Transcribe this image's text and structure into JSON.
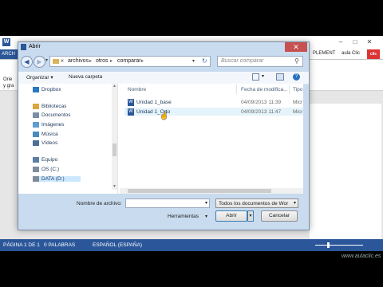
{
  "word": {
    "archivo_tab": "ARCH",
    "ribbon_right_tab": "PLEMENT",
    "account": "aula Clic",
    "ribbon_left_fragments": [
      "Orie",
      "y gra",
      "y"
    ],
    "status": {
      "page": "PÁGINA 1 DE 1",
      "words": "0 PALABRAS",
      "language": "ESPAÑOL (ESPAÑA)"
    }
  },
  "dialog": {
    "title": "Abrir",
    "close": "✕",
    "breadcrumb": [
      "«",
      "archivos",
      "otros",
      "comparar"
    ],
    "search_placeholder": "Buscar comparar",
    "toolbar": {
      "organize": "Organizar ▾",
      "new_folder": "Nueva carpeta"
    },
    "nav": [
      {
        "label": "Dropbox",
        "icon": "dropbox-icon",
        "color": "#2a78c2"
      },
      {
        "label": "Bibliotecas",
        "icon": "libraries-icon",
        "color": "#d9a73d"
      },
      {
        "label": "Documentos",
        "icon": "documents-icon",
        "color": "#7a8fa6"
      },
      {
        "label": "Imágenes",
        "icon": "images-icon",
        "color": "#5f9dcf"
      },
      {
        "label": "Música",
        "icon": "music-icon",
        "color": "#4a8ac0"
      },
      {
        "label": "Vídeos",
        "icon": "videos-icon",
        "color": "#4d6f96"
      },
      {
        "label": "Equipo",
        "icon": "computer-icon",
        "color": "#5a7fa5"
      },
      {
        "label": "OS (C:)",
        "icon": "drive-icon",
        "color": "#7d8c9c"
      },
      {
        "label": "DATA (D:)",
        "icon": "drive-icon",
        "color": "#7d8c9c"
      }
    ],
    "columns": {
      "name": "Nombre",
      "date": "Fecha de modifica...",
      "type": "Tipo"
    },
    "files": [
      {
        "name": "Unidad 1_base",
        "date": "04/09/2013 11:39",
        "type": "Micr"
      },
      {
        "name": "Unidad 1_Orto",
        "date": "04/09/2013 11:47",
        "type": "Micr"
      }
    ],
    "filename_label": "Nombre de archivo:",
    "filename_value": "",
    "filetype_value": "Todos los documentos de Wor",
    "tools_label": "Herramientas",
    "open_label": "Abrir",
    "cancel_label": "Cancelar"
  },
  "watermark": "www.aulaclic.es",
  "colors": {
    "accent": "#2b579a",
    "dialog_frame": "#c9dbee",
    "close": "#c75050"
  }
}
